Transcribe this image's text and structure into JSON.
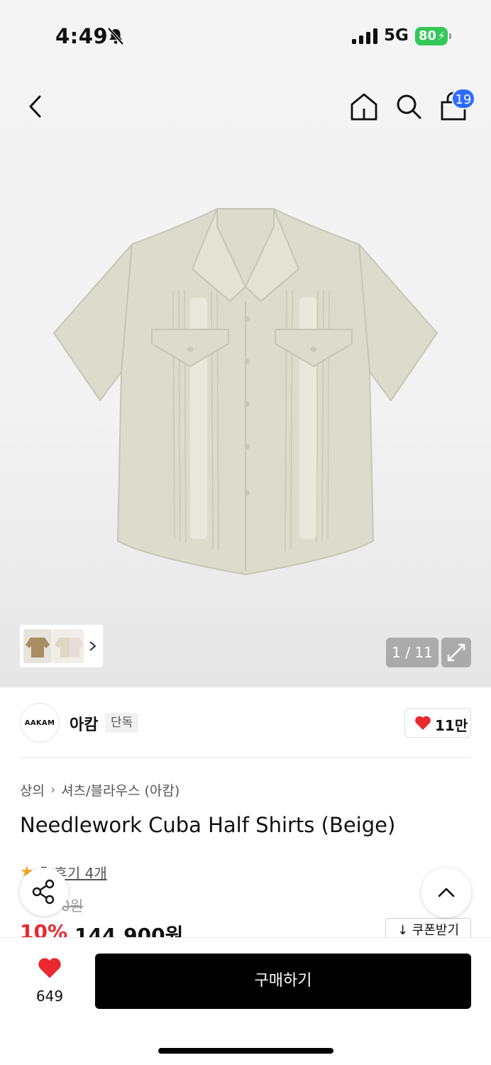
{
  "status_bar": {
    "time": "4:49",
    "network": "5G",
    "battery": "80"
  },
  "nav": {
    "cart_count": "19"
  },
  "gallery": {
    "counter": "1 / 11"
  },
  "brand": {
    "logo_text": "AAKAM",
    "name": "아캄",
    "tag": "단독",
    "likes": "11만"
  },
  "product": {
    "breadcrumb": [
      "상의",
      "셔츠/블라우스 (아캄)"
    ],
    "title": "Needlework Cuba Half Shirts (Beige)",
    "rating_partial": "5",
    "review_label": "후기 4개",
    "original_price_partial": "0원",
    "discount": "10%",
    "price": "144,900원",
    "coupon_label": "↓ 쿠폰받기"
  },
  "bottom_bar": {
    "wish_count": "649",
    "buy_label": "구매하기"
  },
  "colors": {
    "accent_red": "#e8292f",
    "badge_blue": "#2f6bff",
    "battery_green": "#34c759"
  }
}
